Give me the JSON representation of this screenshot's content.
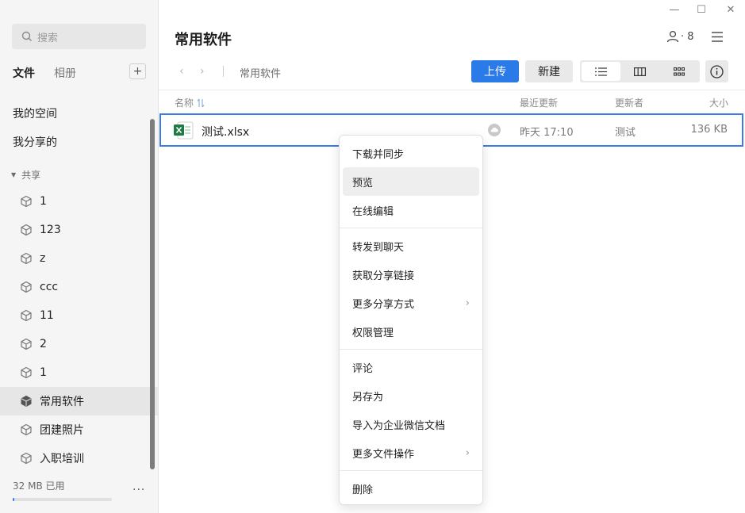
{
  "sidebar": {
    "search_placeholder": "搜索",
    "tabs": [
      {
        "label": "文件"
      },
      {
        "label": "相册"
      }
    ],
    "add_label": "+",
    "nav": [
      {
        "label": "我的空间"
      },
      {
        "label": "我分享的"
      }
    ],
    "shared_header": "共享",
    "shared_items": [
      {
        "label": "1"
      },
      {
        "label": "123"
      },
      {
        "label": "z"
      },
      {
        "label": "ccc"
      },
      {
        "label": "11"
      },
      {
        "label": "2"
      },
      {
        "label": "1"
      },
      {
        "label": "常用软件"
      },
      {
        "label": "团建照片"
      },
      {
        "label": "入职培训"
      }
    ],
    "storage_label": "32 MB 已用",
    "more_label": "···"
  },
  "window": {
    "min": "—",
    "max": "☐",
    "close": "✕"
  },
  "header": {
    "title": "常用软件",
    "member_count": "· 8",
    "breadcrumb": "常用软件",
    "upload_label": "上传",
    "new_label": "新建"
  },
  "columns": {
    "name": "名称",
    "time": "最近更新",
    "user": "更新者",
    "size": "大小"
  },
  "file": {
    "name": "测试.xlsx",
    "time": "昨天 17:10",
    "user": "测试",
    "size": "136 KB"
  },
  "context_menu": {
    "group1": [
      {
        "label": "下载并同步"
      },
      {
        "label": "预览"
      },
      {
        "label": "在线编辑"
      }
    ],
    "group2": [
      {
        "label": "转发到聊天"
      },
      {
        "label": "获取分享链接"
      },
      {
        "label": "更多分享方式"
      },
      {
        "label": "权限管理"
      }
    ],
    "group3": [
      {
        "label": "评论"
      },
      {
        "label": "另存为"
      },
      {
        "label": "导入为企业微信文档"
      },
      {
        "label": "更多文件操作"
      }
    ],
    "group4": [
      {
        "label": "删除"
      }
    ]
  },
  "colors": {
    "accent": "#2a7be8",
    "excel": "#1f7a45"
  }
}
